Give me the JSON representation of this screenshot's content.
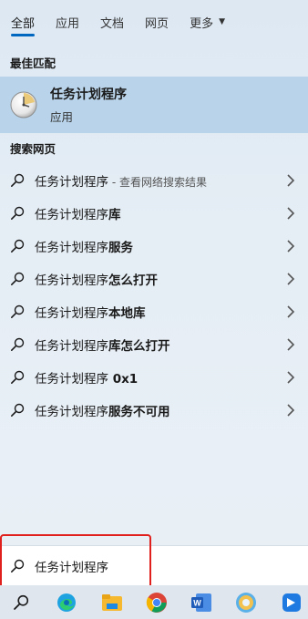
{
  "tabs": [
    {
      "label": "全部"
    },
    {
      "label": "应用"
    },
    {
      "label": "文档"
    },
    {
      "label": "网页"
    },
    {
      "label": "更多"
    }
  ],
  "best_match": {
    "section_label": "最佳匹配",
    "title": "任务计划程序",
    "subtitle": "应用"
  },
  "web_search": {
    "section_label": "搜索网页",
    "results": [
      {
        "prefix": "任务计划程序",
        "bold": "",
        "suffix": " - 查看网络搜索结果"
      },
      {
        "prefix": "任务计划程序",
        "bold": "库",
        "suffix": ""
      },
      {
        "prefix": "任务计划程序",
        "bold": "服务",
        "suffix": ""
      },
      {
        "prefix": "任务计划程序",
        "bold": "怎么打开",
        "suffix": ""
      },
      {
        "prefix": "任务计划程序",
        "bold": "本地库",
        "suffix": ""
      },
      {
        "prefix": "任务计划程序",
        "bold": "库怎么打开",
        "suffix": ""
      },
      {
        "prefix": "任务计划程序",
        "bold": " 0x1",
        "suffix": ""
      },
      {
        "prefix": "任务计划程序",
        "bold": "服务不可用",
        "suffix": ""
      }
    ]
  },
  "search": {
    "value": "任务计划程序"
  },
  "colors": {
    "accent": "#0067c0",
    "highlight": "#b9d4ea",
    "annotation_box": "#e0201c"
  },
  "taskbar": [
    "search-icon",
    "edge-icon",
    "file-explorer-icon",
    "chrome-icon",
    "word-icon",
    "app-icon",
    "notes-app-icon"
  ]
}
